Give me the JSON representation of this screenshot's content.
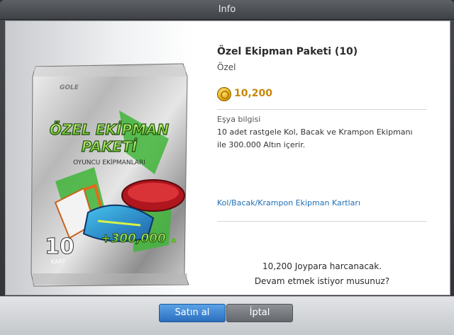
{
  "window": {
    "title": "Info"
  },
  "item": {
    "name": "Özel Ekipman Paketi (10)",
    "category": "Özel",
    "price": "10,200",
    "info_label": "Eşya bilgisi",
    "description_line1": "10 adet rastgele Kol, Bacak ve Krampon Ekipmanı",
    "description_line2": "ile 300.000 Altın içerir.",
    "link": "Kol/Bacak/Krampon Ekipman Kartları"
  },
  "pack": {
    "logo": "GOLE",
    "title_line1": "ÖZEL EKİPMAN",
    "title_line2": "PAKETİ",
    "subtitle": "OYUNCU EKİPMANLARI",
    "count": "10",
    "count_label": "KART",
    "bonus": "+300,000",
    "bonus_unit": "A"
  },
  "confirm": {
    "line1": "10,200 Joypara harcanacak.",
    "line2": "Devam etmek istiyor musunuz?"
  },
  "buttons": {
    "buy": "Satın al",
    "cancel": "İptal"
  },
  "colors": {
    "price": "#c7860b",
    "link": "#1f6fb5",
    "buy_button": "#2c6fbf"
  }
}
